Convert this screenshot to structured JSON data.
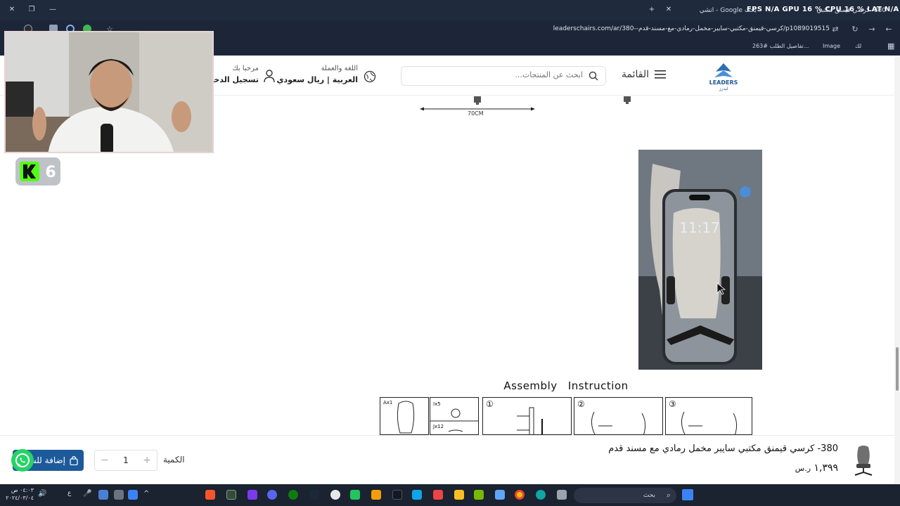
{
  "browser": {
    "tabs": [
      {
        "title": "بحث Google - اتشي"
      },
      {
        "title": "380- كرسي قيمنق مكتبي"
      }
    ],
    "overlay_stats": "FPS N/A  GPU 16 %  CPU 16 %  LAT N/A",
    "url": "leaderschairs.com/ar/380--كرسي-قيمنق-مكتبي-سايبر-مخمل-رمادي-مع-مسند-قدم/p1089019515",
    "bookmarks": [
      "تفاصيل الطلب #263...",
      "Image",
      "لك"
    ]
  },
  "header": {
    "logo_text": "LEADERS",
    "logo_sub": "ليدرز",
    "menu_label": "القائمة",
    "search_placeholder": "ابحث عن المنتجات...",
    "language_title": "اللغة والعملة",
    "language_value": "العربية  |  ريال سعودي",
    "welcome": "مرحبا بك",
    "login": "تسجيل الدخول"
  },
  "content": {
    "dimension_label": "70CM",
    "video_time": "11:17",
    "assembly_title": "Assembly Instruction",
    "assembly_parts": [
      {
        "label": "Ax1"
      },
      {
        "label": "Ix5",
        "label2": "Jx12"
      },
      {
        "label": "①"
      },
      {
        "label": "②"
      },
      {
        "label": "③"
      }
    ]
  },
  "webcam": {
    "badge_count": "6"
  },
  "sticky_bar": {
    "product_name": "380- كرسي قيمنق مكتبي سايبر مخمل رمادي مع مسند قدم",
    "price": "١,٣٩٩",
    "currency": "ر.س",
    "quantity_label": "الكمية",
    "quantity": "1",
    "add_to_cart": "إضافة للسلة"
  },
  "taskbar": {
    "search_placeholder": "بحث",
    "clock_time": "٠٤:٠٣ ص",
    "clock_date": "٢٠٢٤/٠٣/٠٤"
  },
  "colors": {
    "accent": "#1d5a9a",
    "whatsapp": "#25d366",
    "chrome_bg": "#1f2a3d"
  }
}
